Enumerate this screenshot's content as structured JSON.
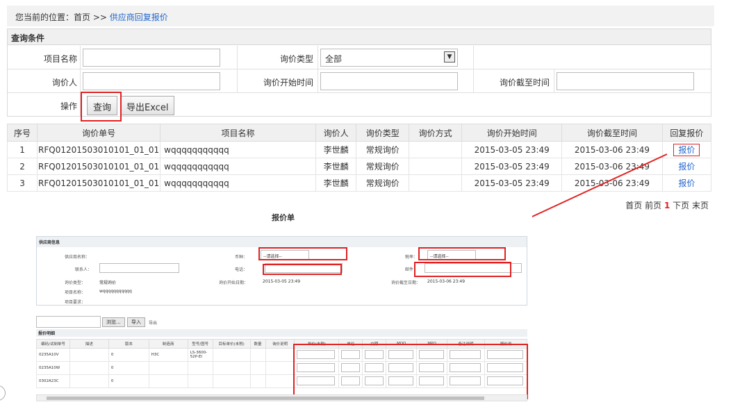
{
  "breadcrumb": {
    "prefix": "您当前的位置：首页 >> ",
    "current": "供应商回复报价"
  },
  "query": {
    "title": "查询条件",
    "project_label": "项目名称",
    "type_label": "询价类型",
    "type_value": "全部",
    "inquirer_label": "询价人",
    "start_label": "询价开始时间",
    "end_label": "询价截至时间",
    "op_label": "操作",
    "search_btn": "查询",
    "export_btn": "导出Excel"
  },
  "grid": {
    "headers": [
      "序号",
      "询价单号",
      "项目名称",
      "询价人",
      "询价类型",
      "询价方式",
      "询价开始时间",
      "询价截至时间",
      "回复报价"
    ],
    "rows": [
      {
        "no": "1",
        "code": "RFQ01201503010101_01_01",
        "project": "wqqqqqqqqqqq",
        "person": "李世麟",
        "type": "常规询价",
        "method": "",
        "start": "2015-03-05 23:49",
        "end": "2015-03-06 23:49",
        "action": "报价"
      },
      {
        "no": "2",
        "code": "RFQ01201503010101_01_01",
        "project": "wqqqqqqqqqqq",
        "person": "李世麟",
        "type": "常规询价",
        "method": "",
        "start": "2015-03-05 23:49",
        "end": "2015-03-06 23:49",
        "action": "报价"
      },
      {
        "no": "3",
        "code": "RFQ01201503010101_01_01",
        "project": "wqqqqqqqqqqq",
        "person": "李世麟",
        "type": "常规询价",
        "method": "",
        "start": "2015-03-05 23:49",
        "end": "2015-03-06 23:49",
        "action": "报价"
      }
    ]
  },
  "pager": {
    "first": "首页",
    "prev": "前页",
    "current": "1",
    "next": "下页",
    "last": "末页"
  },
  "popup": {
    "title": "报价单",
    "supplier_section": "供应商信息",
    "supplier_name_label": "供应商名称：",
    "currency_label": "币种：",
    "currency_value": "--请选择--",
    "tax_label": "税率：",
    "tax_value": "--请选择--",
    "contact_label": "联系人：",
    "phone_label": "电话：",
    "email_label": "邮件：",
    "inq_type_label": "询价类型：",
    "inq_type_value": "常规询价",
    "inq_start_label": "询价开始日期：",
    "inq_start_value": "2015-03-05 23:49",
    "inq_end_label": "询价截至日期：",
    "inq_end_value": "2015-03-06 23:49",
    "proj_name_label": "项目名称：",
    "proj_name_value": "wqqqqqqqqqqq",
    "proj_req_label": "项目要求：",
    "browse_btn": "浏览...",
    "import_btn": "导入",
    "export_link": "导出",
    "detail_section": "报价明细",
    "table_headers": [
      "编码/试制单号",
      "描述",
      "版本",
      "制造商",
      "型号/图号",
      "目标单价(未税)",
      "数量",
      "询价说明",
      "单价(未税)",
      "单位",
      "交期",
      "MOQ",
      "MPQ",
      "备注说明",
      "报价说"
    ],
    "rows": [
      {
        "code": "0235A10V",
        "version": "0",
        "maker": "H3C",
        "model": "LS-3600-52P-EI"
      },
      {
        "code": "0235A10W",
        "version": "0",
        "maker": "",
        "model": ""
      },
      {
        "code": "0302A23C",
        "version": "0",
        "maker": "",
        "model": ""
      }
    ]
  },
  "colors": {
    "link": "#2266cc",
    "highlight": "#e02020"
  }
}
